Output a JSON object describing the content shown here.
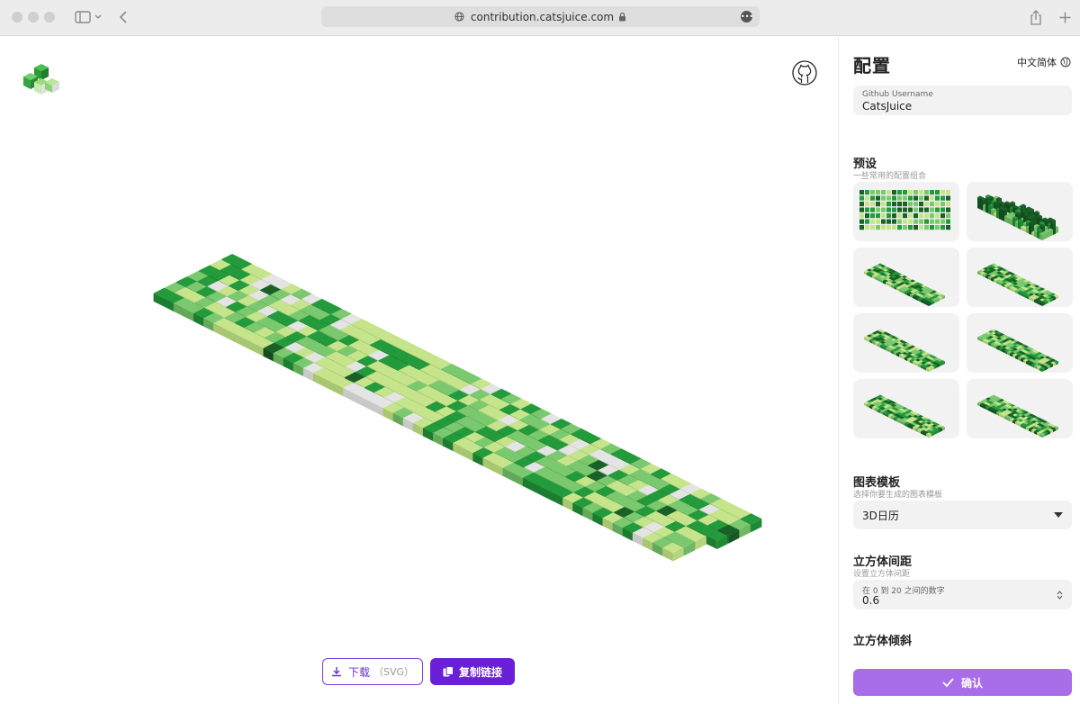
{
  "browser": {
    "url": "contribution.catsjuice.com"
  },
  "main": {
    "download_label": "下载",
    "download_sub": "（SVG）",
    "copy_label": "复制链接"
  },
  "sidebar": {
    "title": "配置",
    "language": "中文简体",
    "username_label": "Github Username",
    "username_value": "CatsJuice",
    "presets_title": "预设",
    "presets_desc": "一些常用的配置组合",
    "template_title": "图表模板",
    "template_desc": "选择你要生成的图表模板",
    "template_value": "3D日历",
    "gap_title": "立方体间距",
    "gap_desc": "设置立方体间距",
    "gap_hint": "在 0 到 20 之间的数字",
    "gap_value": "0.6",
    "tilt_title": "立方体倾斜",
    "confirm_label": "确认"
  },
  "colors": {
    "accent": "#6a1fd9",
    "level0": "#e4e4e4",
    "level1": "#c6e48b",
    "level2": "#7bc96f",
    "level3": "#239a3b",
    "level4": "#196127"
  }
}
